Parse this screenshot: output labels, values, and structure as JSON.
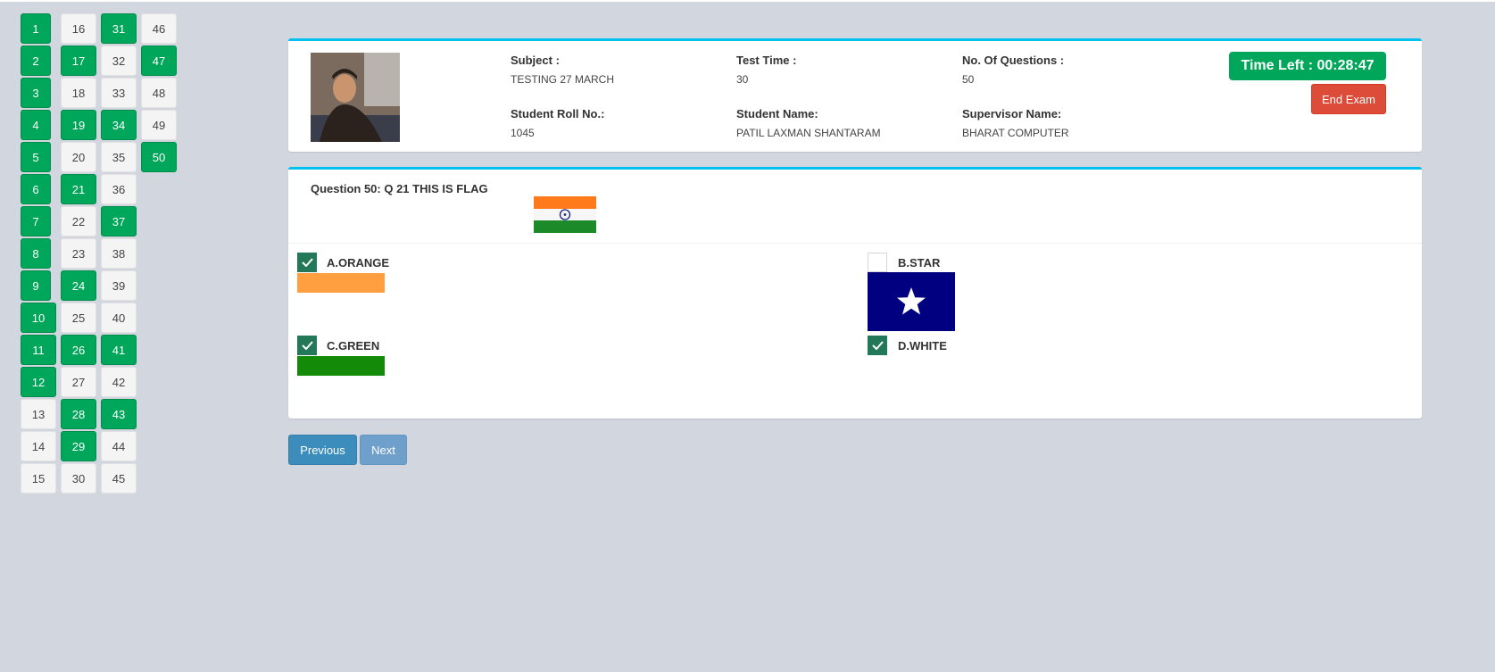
{
  "palette": {
    "columns": [
      [
        {
          "n": "1",
          "answered": true
        },
        {
          "n": "2",
          "answered": true
        },
        {
          "n": "3",
          "answered": true
        },
        {
          "n": "4",
          "answered": true
        },
        {
          "n": "5",
          "answered": true
        },
        {
          "n": "6",
          "answered": true
        },
        {
          "n": "7",
          "answered": true
        },
        {
          "n": "8",
          "answered": true
        },
        {
          "n": "9",
          "answered": true
        },
        {
          "n": "10",
          "answered": true
        },
        {
          "n": "11",
          "answered": true
        },
        {
          "n": "12",
          "answered": true
        },
        {
          "n": "13",
          "answered": false
        },
        {
          "n": "14",
          "answered": false
        },
        {
          "n": "15",
          "answered": false
        }
      ],
      [
        {
          "n": "16",
          "answered": false
        },
        {
          "n": "17",
          "answered": true
        },
        {
          "n": "18",
          "answered": false
        },
        {
          "n": "19",
          "answered": true
        },
        {
          "n": "20",
          "answered": false
        },
        {
          "n": "21",
          "answered": true
        },
        {
          "n": "22",
          "answered": false
        },
        {
          "n": "23",
          "answered": false
        },
        {
          "n": "24",
          "answered": true
        },
        {
          "n": "25",
          "answered": false
        },
        {
          "n": "26",
          "answered": true
        },
        {
          "n": "27",
          "answered": false
        },
        {
          "n": "28",
          "answered": true
        },
        {
          "n": "29",
          "answered": true
        },
        {
          "n": "30",
          "answered": false
        }
      ],
      [
        {
          "n": "31",
          "answered": true
        },
        {
          "n": "32",
          "answered": false
        },
        {
          "n": "33",
          "answered": false
        },
        {
          "n": "34",
          "answered": true
        },
        {
          "n": "35",
          "answered": false
        },
        {
          "n": "36",
          "answered": false
        },
        {
          "n": "37",
          "answered": true
        },
        {
          "n": "38",
          "answered": false
        },
        {
          "n": "39",
          "answered": false
        },
        {
          "n": "40",
          "answered": false
        },
        {
          "n": "41",
          "answered": true
        },
        {
          "n": "42",
          "answered": false
        },
        {
          "n": "43",
          "answered": true
        },
        {
          "n": "44",
          "answered": false
        },
        {
          "n": "45",
          "answered": false
        }
      ],
      [
        {
          "n": "46",
          "answered": false
        },
        {
          "n": "47",
          "answered": true
        },
        {
          "n": "48",
          "answered": false
        },
        {
          "n": "49",
          "answered": false
        },
        {
          "n": "50",
          "answered": true
        }
      ]
    ]
  },
  "info": {
    "subject_label": "Subject :",
    "subject_value": "TESTING 27 MARCH",
    "test_time_label": "Test Time :",
    "test_time_value": "30",
    "num_questions_label": "No. Of Questions :",
    "num_questions_value": "50",
    "roll_label": "Student Roll No.:",
    "roll_value": "1045",
    "name_label": "Student Name:",
    "name_value": "PATIL LAXMAN SHANTARAM",
    "supervisor_label": "Supervisor Name:",
    "supervisor_value": "BHARAT COMPUTER",
    "timer_text": "Time Left : 00:28:47",
    "end_exam_label": "End Exam"
  },
  "question": {
    "text": "Question 50: Q 21 THIS IS FLAG",
    "options": [
      {
        "label": "A.ORANGE",
        "checked": true
      },
      {
        "label": "B.STAR",
        "checked": false
      },
      {
        "label": "C.GREEN",
        "checked": true
      },
      {
        "label": "D.WHITE",
        "checked": true
      }
    ]
  },
  "nav": {
    "previous_label": "Previous",
    "next_label": "Next"
  },
  "colors": {
    "answered": "#00a65a",
    "card_accent": "#00c0ef",
    "checkbox_on": "#23785a",
    "orange_swatch": "#ff9f3f",
    "green_swatch": "#138a08",
    "star_bg": "#000080",
    "danger": "#dd4b39",
    "primary": "#3c8dbc"
  },
  "icons": [
    "check-icon",
    "star-icon",
    "indian-flag-icon",
    "student-photo"
  ]
}
